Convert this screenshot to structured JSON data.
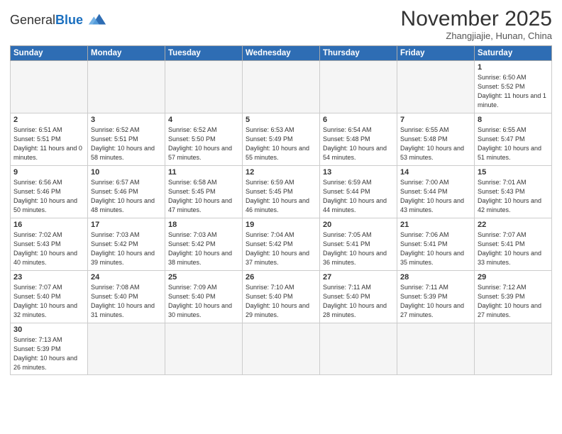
{
  "logo": {
    "text_general": "General",
    "text_blue": "Blue"
  },
  "header": {
    "month_title": "November 2025",
    "subtitle": "Zhangjiajie, Hunan, China"
  },
  "weekdays": [
    "Sunday",
    "Monday",
    "Tuesday",
    "Wednesday",
    "Thursday",
    "Friday",
    "Saturday"
  ],
  "weeks": [
    [
      {
        "day": "",
        "info": "",
        "empty": true
      },
      {
        "day": "",
        "info": "",
        "empty": true
      },
      {
        "day": "",
        "info": "",
        "empty": true
      },
      {
        "day": "",
        "info": "",
        "empty": true
      },
      {
        "day": "",
        "info": "",
        "empty": true
      },
      {
        "day": "",
        "info": "",
        "empty": true
      },
      {
        "day": "1",
        "info": "Sunrise: 6:50 AM\nSunset: 5:52 PM\nDaylight: 11 hours and 1 minute.",
        "empty": false
      }
    ],
    [
      {
        "day": "2",
        "info": "Sunrise: 6:51 AM\nSunset: 5:51 PM\nDaylight: 11 hours and 0 minutes.",
        "empty": false
      },
      {
        "day": "3",
        "info": "Sunrise: 6:52 AM\nSunset: 5:51 PM\nDaylight: 10 hours and 58 minutes.",
        "empty": false
      },
      {
        "day": "4",
        "info": "Sunrise: 6:52 AM\nSunset: 5:50 PM\nDaylight: 10 hours and 57 minutes.",
        "empty": false
      },
      {
        "day": "5",
        "info": "Sunrise: 6:53 AM\nSunset: 5:49 PM\nDaylight: 10 hours and 55 minutes.",
        "empty": false
      },
      {
        "day": "6",
        "info": "Sunrise: 6:54 AM\nSunset: 5:48 PM\nDaylight: 10 hours and 54 minutes.",
        "empty": false
      },
      {
        "day": "7",
        "info": "Sunrise: 6:55 AM\nSunset: 5:48 PM\nDaylight: 10 hours and 53 minutes.",
        "empty": false
      },
      {
        "day": "8",
        "info": "Sunrise: 6:55 AM\nSunset: 5:47 PM\nDaylight: 10 hours and 51 minutes.",
        "empty": false
      }
    ],
    [
      {
        "day": "9",
        "info": "Sunrise: 6:56 AM\nSunset: 5:46 PM\nDaylight: 10 hours and 50 minutes.",
        "empty": false
      },
      {
        "day": "10",
        "info": "Sunrise: 6:57 AM\nSunset: 5:46 PM\nDaylight: 10 hours and 48 minutes.",
        "empty": false
      },
      {
        "day": "11",
        "info": "Sunrise: 6:58 AM\nSunset: 5:45 PM\nDaylight: 10 hours and 47 minutes.",
        "empty": false
      },
      {
        "day": "12",
        "info": "Sunrise: 6:59 AM\nSunset: 5:45 PM\nDaylight: 10 hours and 46 minutes.",
        "empty": false
      },
      {
        "day": "13",
        "info": "Sunrise: 6:59 AM\nSunset: 5:44 PM\nDaylight: 10 hours and 44 minutes.",
        "empty": false
      },
      {
        "day": "14",
        "info": "Sunrise: 7:00 AM\nSunset: 5:44 PM\nDaylight: 10 hours and 43 minutes.",
        "empty": false
      },
      {
        "day": "15",
        "info": "Sunrise: 7:01 AM\nSunset: 5:43 PM\nDaylight: 10 hours and 42 minutes.",
        "empty": false
      }
    ],
    [
      {
        "day": "16",
        "info": "Sunrise: 7:02 AM\nSunset: 5:43 PM\nDaylight: 10 hours and 40 minutes.",
        "empty": false
      },
      {
        "day": "17",
        "info": "Sunrise: 7:03 AM\nSunset: 5:42 PM\nDaylight: 10 hours and 39 minutes.",
        "empty": false
      },
      {
        "day": "18",
        "info": "Sunrise: 7:03 AM\nSunset: 5:42 PM\nDaylight: 10 hours and 38 minutes.",
        "empty": false
      },
      {
        "day": "19",
        "info": "Sunrise: 7:04 AM\nSunset: 5:42 PM\nDaylight: 10 hours and 37 minutes.",
        "empty": false
      },
      {
        "day": "20",
        "info": "Sunrise: 7:05 AM\nSunset: 5:41 PM\nDaylight: 10 hours and 36 minutes.",
        "empty": false
      },
      {
        "day": "21",
        "info": "Sunrise: 7:06 AM\nSunset: 5:41 PM\nDaylight: 10 hours and 35 minutes.",
        "empty": false
      },
      {
        "day": "22",
        "info": "Sunrise: 7:07 AM\nSunset: 5:41 PM\nDaylight: 10 hours and 33 minutes.",
        "empty": false
      }
    ],
    [
      {
        "day": "23",
        "info": "Sunrise: 7:07 AM\nSunset: 5:40 PM\nDaylight: 10 hours and 32 minutes.",
        "empty": false
      },
      {
        "day": "24",
        "info": "Sunrise: 7:08 AM\nSunset: 5:40 PM\nDaylight: 10 hours and 31 minutes.",
        "empty": false
      },
      {
        "day": "25",
        "info": "Sunrise: 7:09 AM\nSunset: 5:40 PM\nDaylight: 10 hours and 30 minutes.",
        "empty": false
      },
      {
        "day": "26",
        "info": "Sunrise: 7:10 AM\nSunset: 5:40 PM\nDaylight: 10 hours and 29 minutes.",
        "empty": false
      },
      {
        "day": "27",
        "info": "Sunrise: 7:11 AM\nSunset: 5:40 PM\nDaylight: 10 hours and 28 minutes.",
        "empty": false
      },
      {
        "day": "28",
        "info": "Sunrise: 7:11 AM\nSunset: 5:39 PM\nDaylight: 10 hours and 27 minutes.",
        "empty": false
      },
      {
        "day": "29",
        "info": "Sunrise: 7:12 AM\nSunset: 5:39 PM\nDaylight: 10 hours and 27 minutes.",
        "empty": false
      }
    ],
    [
      {
        "day": "30",
        "info": "Sunrise: 7:13 AM\nSunset: 5:39 PM\nDaylight: 10 hours and 26 minutes.",
        "empty": false
      },
      {
        "day": "",
        "info": "",
        "empty": true
      },
      {
        "day": "",
        "info": "",
        "empty": true
      },
      {
        "day": "",
        "info": "",
        "empty": true
      },
      {
        "day": "",
        "info": "",
        "empty": true
      },
      {
        "day": "",
        "info": "",
        "empty": true
      },
      {
        "day": "",
        "info": "",
        "empty": true
      }
    ]
  ]
}
